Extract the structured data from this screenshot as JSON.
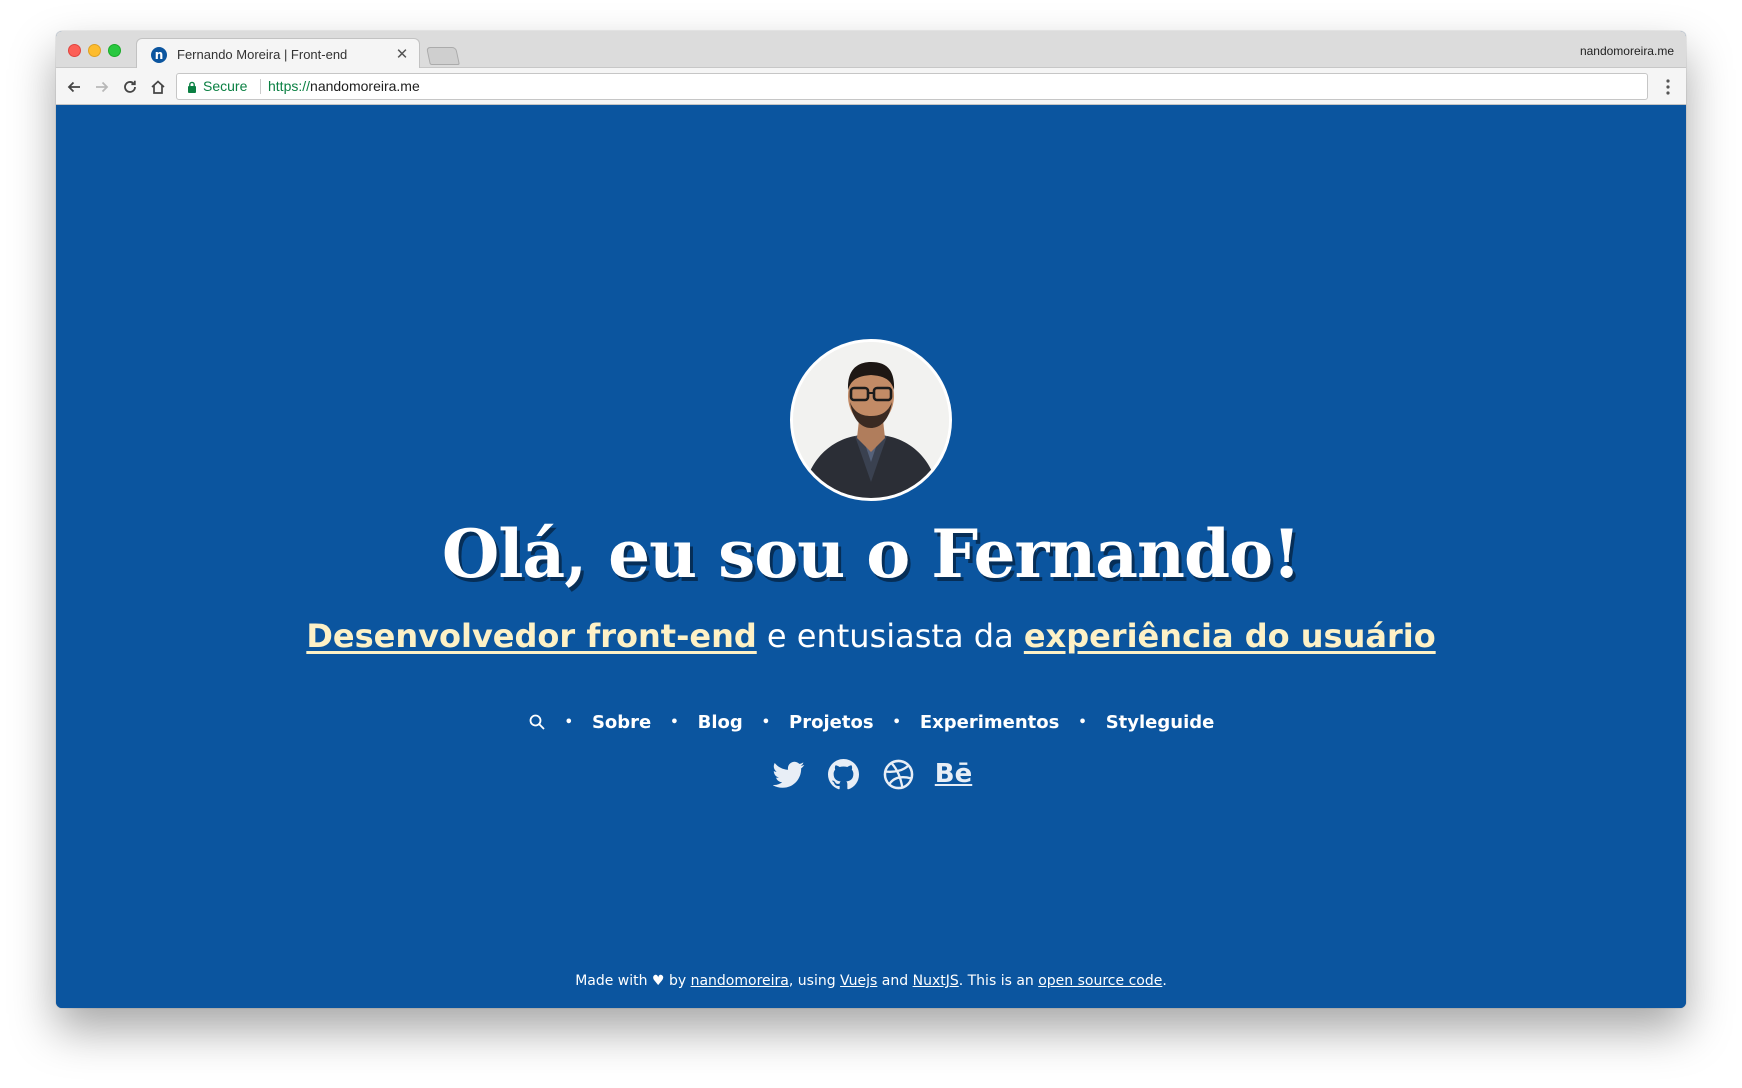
{
  "browser": {
    "tab_title": "Fernando Moreira | Front-end",
    "tab_close": "✕",
    "favicon_letter": "n",
    "profile_name": "nandomoreira.me",
    "secure_label": "Secure",
    "url_scheme": "https://",
    "url_host": "nandomoreira.me"
  },
  "hero": {
    "title": "Olá, eu sou o Fernando!",
    "subtitle_link1": "Desenvolvedor front-end",
    "subtitle_middle": " e entusiasta da ",
    "subtitle_link2": "experiência do usuário"
  },
  "nav": {
    "items": [
      "Sobre",
      "Blog",
      "Projetos",
      "Experimentos",
      "Styleguide"
    ],
    "separator": "•"
  },
  "social": {
    "icons": [
      "twitter-icon",
      "github-icon",
      "dribbble-icon",
      "behance-icon"
    ],
    "behance_label": "Bē"
  },
  "footer": {
    "t1": "Made with ♥ by ",
    "link_author": "nandomoreira",
    "t2": ", using ",
    "link_vue": "Vuejs",
    "t3": " and ",
    "link_nuxt": "NuxtJS",
    "t4": ". This is an ",
    "link_source": "open source code",
    "t5": "."
  },
  "colors": {
    "page_background": "#0b559f",
    "subtitle_link": "#fdf1c6",
    "secure_green": "#0b8043"
  }
}
